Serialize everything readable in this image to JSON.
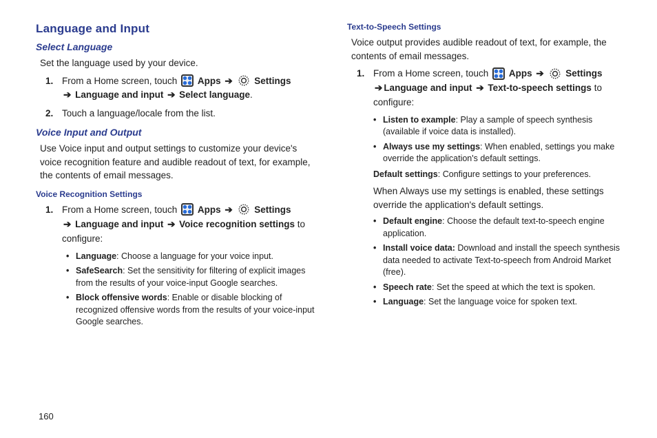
{
  "page_number": "160",
  "left": {
    "h1": "Language and Input",
    "sel_lang": {
      "h2": "Select Language",
      "intro": "Set the language used by your device.",
      "step1_num": "1.",
      "step1_a": "From a Home screen, touch ",
      "apps": "Apps",
      "settings": "Settings",
      "step1_path1": "Language and input",
      "step1_path2": "Select language",
      "step2_num": "2.",
      "step2": "Touch a language/locale from the list."
    },
    "voice_io": {
      "h2": "Voice Input and Output",
      "intro": "Use Voice input and output settings to customize your device's voice recognition feature and audible readout of text, for example, the contents of email messages."
    },
    "vrs": {
      "h3": "Voice Recognition Settings",
      "step1_num": "1.",
      "step1_a": "From a Home screen, touch ",
      "apps": "Apps",
      "settings": "Settings",
      "path1": "Language and input",
      "path2": "Voice recognition settings",
      "configure": " to configure:",
      "b1_label": "Language",
      "b1_body": ": Choose a language for your voice input.",
      "b2_label": "SafeSearch",
      "b2_body": ": Set the sensitivity for filtering of explicit images from the results of your voice-input Google searches.",
      "b3_label": "Block offensive words",
      "b3_body": ": Enable or disable blocking of recognized offensive words from the results of your voice-input Google searches."
    }
  },
  "right": {
    "tts": {
      "h3": "Text-to-Speech Settings",
      "intro": "Voice output provides audible readout of text, for example, the contents of email messages.",
      "step1_num": "1.",
      "step1_a": "From a Home screen, touch ",
      "apps": "Apps",
      "settings": "Settings",
      "path1": "Language and input",
      "path2": "Text-to-speech settings",
      "configure": " to configure:",
      "b1_label": "Listen to example",
      "b1_body": ": Play a sample of speech synthesis (available if voice data is installed).",
      "b2_label": "Always use my settings",
      "b2_body": ": When enabled, settings you make override the application's default settings.",
      "ds_label": "Default settings",
      "ds_body": ": Configure settings to your preferences.",
      "ds_extra": "When Always use my settings is enabled, these settings override the application's default settings.",
      "b3_label": "Default engine",
      "b3_body": ": Choose the default text-to-speech engine application.",
      "b4_label": "Install voice data:",
      "b4_body": " Download and install the speech synthesis data needed to activate Text-to-speech from Android Market (free).",
      "b5_label": "Speech rate",
      "b5_body": ": Set the speed at which the text is spoken.",
      "b6_label": "Language",
      "b6_body": ": Set the language voice for spoken text."
    }
  },
  "arrow": "➔",
  "bullet": "•"
}
